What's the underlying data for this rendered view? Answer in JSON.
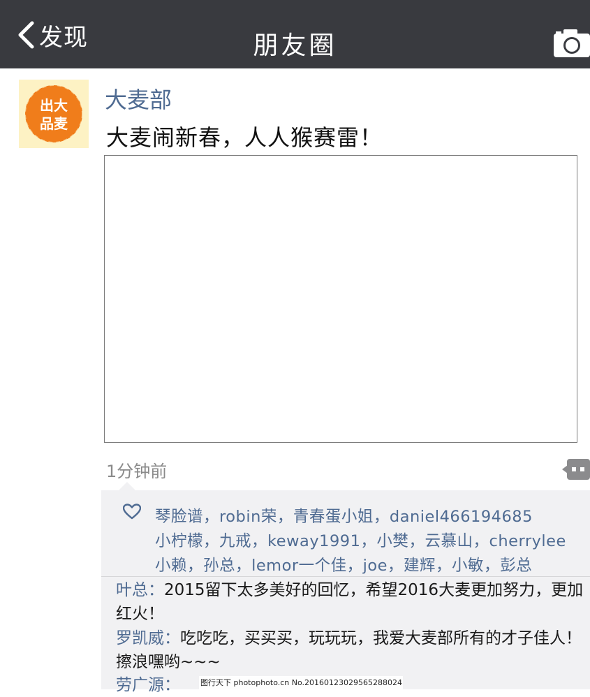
{
  "nav": {
    "back_label": "发现",
    "title": "朋友圈",
    "camera_icon": "camera-icon",
    "back_icon": "chevron-left-icon",
    "bar_color": "#393a3f"
  },
  "post": {
    "avatar": {
      "line1": "出大",
      "line2": "品麦",
      "circle_color": "#f07d1b",
      "bg_color": "#fdf2c4"
    },
    "user_name": "大麦部",
    "text": "大麦闹新春，人人猴赛雷！",
    "time": "1分钟前",
    "name_color": "#4f6b92"
  },
  "likes": {
    "icon": "heart-outline-icon",
    "rows": [
      [
        "琴脸谱",
        "robin荣",
        "青春蛋小姐",
        "daniel466194685"
      ],
      [
        "小柠檬",
        "九戒",
        "keway1991",
        "小樊",
        "云慕山",
        "cherrylee"
      ],
      [
        "小赖",
        "孙总",
        "lemor一个佳",
        "joe",
        "建辉",
        "小敏",
        "彭总"
      ]
    ],
    "separator": "，"
  },
  "comments": [
    {
      "author": "叶总",
      "text": "2015留下太多美好的回忆，希望2016大麦更加努力，更加红火！"
    },
    {
      "author": "罗凯威",
      "text": "吃吃吃，买买买，玩玩玩，我爱大麦部所有的才子佳人！擦浪嘿哟~~~"
    },
    {
      "author": "劳广源",
      "text": ""
    }
  ],
  "comment_colon": "：",
  "watermark": "图行天下 photophoto.cn No.20160123029565288024"
}
